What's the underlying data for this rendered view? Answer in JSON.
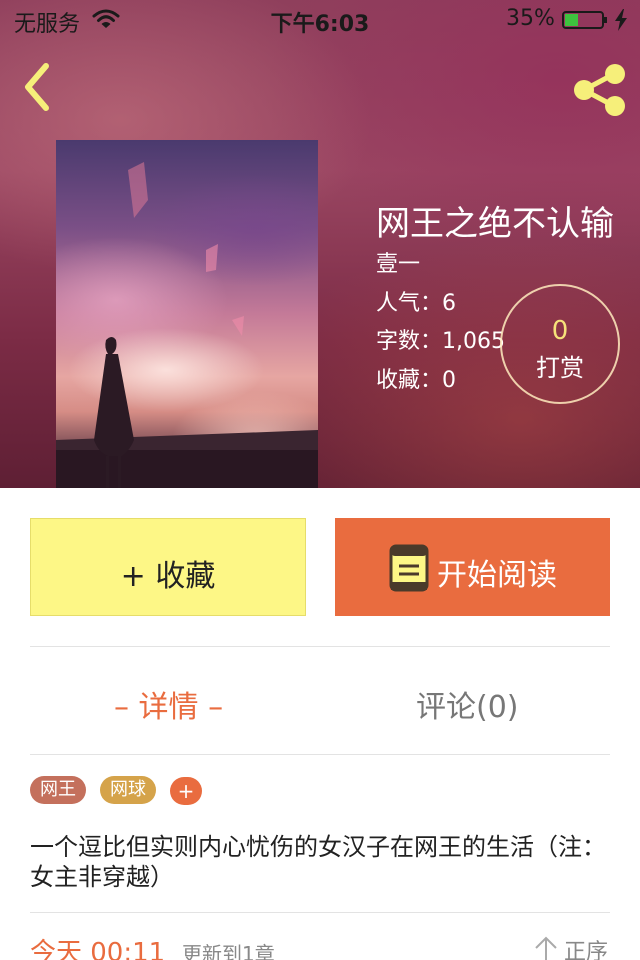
{
  "status_bar": {
    "carrier": "无服务",
    "time": "下午6:03",
    "battery": "35%"
  },
  "book": {
    "title": "网王之绝不认输",
    "author": "壹一",
    "popularity": "人气：6",
    "word_count": "字数：1,065",
    "favorites": "收藏：0",
    "tip_count": "0",
    "tip_label": "打赏"
  },
  "actions": {
    "favorite_label": "+ 收藏",
    "read_label": "开始阅读"
  },
  "tabs": [
    {
      "label": "– 详情 –",
      "active": true
    },
    {
      "label": "评论(0)",
      "active": false
    }
  ],
  "tags": [
    "网王",
    "网球",
    "+"
  ],
  "synopsis": "一个逗比但实则内心忧伤的女汉子在网王的生活（注：女主非穿越）",
  "update": {
    "date": "今天 00:11",
    "text": "更新到1章",
    "sort_label": "正序"
  },
  "colors": {
    "accent": "#e96c3f",
    "favorite_button": "#fdf786",
    "tip_count": "#f7e27a",
    "icon_yellow": "#f6ef7a"
  },
  "icons": [
    "wifi-icon",
    "battery-icon",
    "charging-bolt-icon",
    "back-chevron-icon",
    "share-icon",
    "book-icon",
    "sort-arrow-icon"
  ]
}
